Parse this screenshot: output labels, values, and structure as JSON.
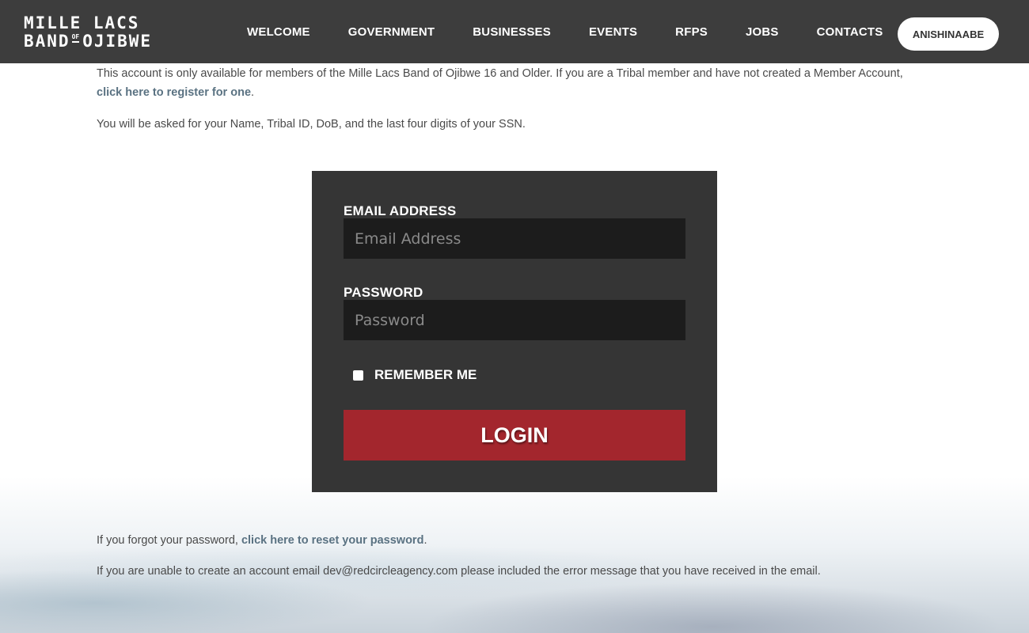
{
  "header": {
    "logo_line1": "MILLE LACS",
    "logo_line2_a": "BAND",
    "logo_of": "OF",
    "logo_line2_b": "OJIBWE",
    "nav": [
      "WELCOME",
      "GOVERNMENT",
      "BUSINESSES",
      "EVENTS",
      "RFPS",
      "JOBS",
      "CONTACTS"
    ],
    "language_button": "ANISHINAABE"
  },
  "intro": {
    "text": "This account is only available for members of the Mille Lacs Band of Ojibwe 16 and Older. If you are a Tribal member and have not created a Member Account,",
    "register_link": "click here to register for one",
    "period": ".",
    "requirements": "You will be asked for your Name, Tribal ID, DoB, and the last four digits of your SSN."
  },
  "login_form": {
    "email_label": "EMAIL ADDRESS",
    "email_placeholder": "Email Address",
    "email_value": "",
    "password_label": "PASSWORD",
    "password_placeholder": "Password",
    "password_value": "",
    "remember_label": "REMEMBER ME",
    "remember_checked": false,
    "login_button": "LOGIN",
    "button_color": "#a3262d"
  },
  "footer_text": {
    "forgot_prefix": "If you forgot your password,",
    "reset_link": "click here to reset your password",
    "period": ".",
    "support_text": "If you are unable to create an account email dev@redcircleagency.com please included the error message that you have received in the email."
  },
  "colors": {
    "header_bg": "#3d3d3d",
    "form_bg": "#353535",
    "input_bg": "#1c1c1c",
    "link": "#5a7282"
  }
}
